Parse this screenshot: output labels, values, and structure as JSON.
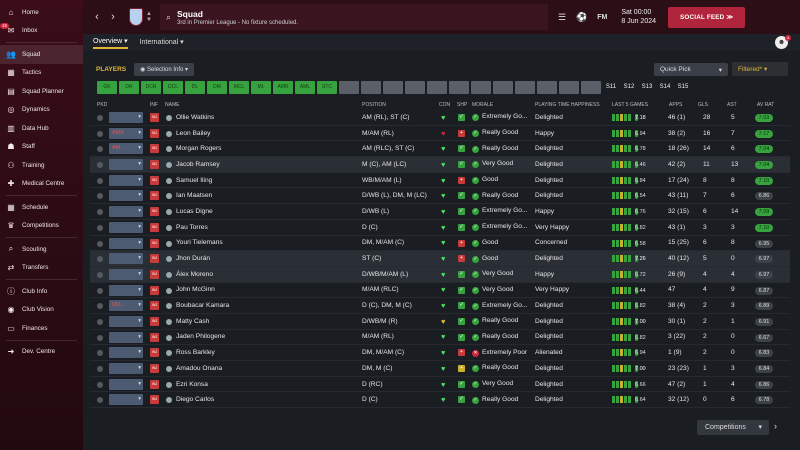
{
  "sidebar": {
    "inbox_badge": "15",
    "items": [
      {
        "label": "Home",
        "icon": "home-icon",
        "glyph": "⌂"
      },
      {
        "label": "Inbox",
        "icon": "inbox-icon",
        "glyph": "✉"
      },
      {
        "label": "Squad",
        "icon": "squad-icon",
        "glyph": "👥"
      },
      {
        "label": "Tactics",
        "icon": "tactics-icon",
        "glyph": "▦"
      },
      {
        "label": "Squad Planner",
        "icon": "planner-icon",
        "glyph": "▤"
      },
      {
        "label": "Dynamics",
        "icon": "dynamics-icon",
        "glyph": "◎"
      },
      {
        "label": "Data Hub",
        "icon": "data-hub-icon",
        "glyph": "▥"
      },
      {
        "label": "Staff",
        "icon": "staff-icon",
        "glyph": "☗"
      },
      {
        "label": "Training",
        "icon": "training-icon",
        "glyph": "⚇"
      },
      {
        "label": "Medical Centre",
        "icon": "medical-icon",
        "glyph": "✚"
      },
      {
        "label": "Schedule",
        "icon": "schedule-icon",
        "glyph": "▦"
      },
      {
        "label": "Competitions",
        "icon": "trophy-icon",
        "glyph": "♛"
      },
      {
        "label": "Scouting",
        "icon": "scouting-icon",
        "glyph": "⌕"
      },
      {
        "label": "Transfers",
        "icon": "transfers-icon",
        "glyph": "⇄"
      },
      {
        "label": "Club Info",
        "icon": "club-info-icon",
        "glyph": "ⓘ"
      },
      {
        "label": "Club Vision",
        "icon": "club-vision-icon",
        "glyph": "◉"
      },
      {
        "label": "Finances",
        "icon": "finances-icon",
        "glyph": "▭"
      },
      {
        "label": "Dev. Centre",
        "icon": "dev-centre-icon",
        "glyph": "➜"
      }
    ]
  },
  "topbar": {
    "title": "Squad",
    "subtitle": "3rd in Premier League - No fixture scheduled.",
    "time": "Sat 00:00",
    "date": "8 Jun 2024",
    "social_feed": "SOCIAL FEED",
    "fm_label": "FM"
  },
  "subbar": {
    "tabs": [
      "Overview",
      "International"
    ],
    "user_badge": "4"
  },
  "players_bar": {
    "label": "PLAYERS",
    "selection_info": "Selection Info",
    "quick_pick": "Quick Pick",
    "filtered": "Filtered*"
  },
  "chips": {
    "green": [
      "GK",
      "DR",
      "DCR",
      "DCL",
      "DL",
      "DM",
      "MCL",
      "ML",
      "AMR",
      "AML",
      "STC"
    ],
    "grey": [
      "",
      "",
      "",
      "",
      "",
      "",
      "",
      "",
      "",
      "",
      "",
      ""
    ],
    "text": [
      "S11",
      "S12",
      "S13",
      "S14",
      "S15"
    ]
  },
  "columns": {
    "pkd": "PKD",
    "inf": "INF",
    "name": "NAME",
    "position": "POSITION",
    "con": "CON",
    "shp": "SHP",
    "morale": "MORALE",
    "pth": "PLAYING TIME HAPPINESS",
    "last5": "LAST 5 GAMES",
    "apps": "APPS",
    "gls": "GLS",
    "ast": "AST",
    "avrat": "AV RAT"
  },
  "players": [
    {
      "pkd": "",
      "name": "Ollie Watkins",
      "pos": "AM (RL), ST (C)",
      "morale": "Extremely Go...",
      "pth": "Delighted",
      "last": "7.18",
      "apps": "46 (1)",
      "gls": "28",
      "ast": "5",
      "av": "7.03",
      "avg": true,
      "lastg": true,
      "con": "#4cd964",
      "shp": "#36a33e",
      "mor": "#36a33e"
    },
    {
      "pkd": "AMR",
      "name": "Leon Bailey",
      "pos": "M/AM (RL)",
      "morale": "Really Good",
      "pth": "Happy",
      "last": "6.94",
      "apps": "38 (2)",
      "gls": "16",
      "ast": "7",
      "av": "7.17",
      "avg": true,
      "lastg": false,
      "con": "#d0243a",
      "shp": "#c93a3a",
      "mor": "#36a33e"
    },
    {
      "pkd": "AM...",
      "name": "Morgan Rogers",
      "pos": "AM (RLC), ST (C)",
      "morale": "Really Good",
      "pth": "Delighted",
      "last": "6.78",
      "apps": "18 (26)",
      "gls": "14",
      "ast": "6",
      "av": "7.04",
      "avg": true,
      "lastg": false,
      "con": "#4cd964",
      "shp": "#36a33e",
      "mor": "#36a33e"
    },
    {
      "pkd": "",
      "name": "Jacob Ramsey",
      "pos": "M (C), AM (LC)",
      "morale": "Very Good",
      "pth": "Delighted",
      "last": "6.46",
      "apps": "42 (2)",
      "gls": "11",
      "ast": "13",
      "av": "7.04",
      "avg": true,
      "lastg": false,
      "con": "#4cd964",
      "shp": "#36a33e",
      "mor": "#36a33e"
    },
    {
      "pkd": "",
      "name": "Samuel Iling",
      "pos": "WB/M/AM (L)",
      "morale": "Good",
      "pth": "Delighted",
      "last": "6.84",
      "apps": "17 (24)",
      "gls": "8",
      "ast": "8",
      "av": "7.10",
      "avg": true,
      "lastg": false,
      "con": "#4cd964",
      "shp": "#c93a3a",
      "mor": "#36a33e"
    },
    {
      "pkd": "",
      "name": "Ian Maatsen",
      "pos": "D/WB (L), DM, M (LC)",
      "morale": "Really Good",
      "pth": "Delighted",
      "last": "6.54",
      "apps": "43 (11)",
      "gls": "7",
      "ast": "6",
      "av": "6.86",
      "avg": false,
      "lastg": false,
      "con": "#4cd964",
      "shp": "#36a33e",
      "mor": "#36a33e"
    },
    {
      "pkd": "",
      "name": "Lucas Digne",
      "pos": "D/WB (L)",
      "morale": "Extremely Go...",
      "pth": "Happy",
      "last": "6.76",
      "apps": "32 (15)",
      "gls": "6",
      "ast": "14",
      "av": "7.09",
      "avg": true,
      "lastg": false,
      "con": "#4cd964",
      "shp": "#36a33e",
      "mor": "#36a33e"
    },
    {
      "pkd": "",
      "name": "Pau Torres",
      "pos": "D (C)",
      "morale": "Extremely Go...",
      "pth": "Very Happy",
      "last": "6.82",
      "apps": "43 (1)",
      "gls": "3",
      "ast": "3",
      "av": "7.10",
      "avg": true,
      "lastg": false,
      "con": "#4cd964",
      "shp": "#36a33e",
      "mor": "#36a33e"
    },
    {
      "pkd": "",
      "name": "Youri Tielemans",
      "pos": "DM, M/AM (C)",
      "morale": "Good",
      "pth": "Concerned",
      "last": "6.58",
      "apps": "15 (25)",
      "gls": "6",
      "ast": "8",
      "av": "6.95",
      "avg": false,
      "lastg": false,
      "con": "#4cd964",
      "shp": "#c93a3a",
      "mor": "#36a33e"
    },
    {
      "pkd": "",
      "name": "Jhon Durán",
      "pos": "ST (C)",
      "morale": "Good",
      "pth": "Delighted",
      "last": "7.26",
      "apps": "40 (12)",
      "gls": "5",
      "ast": "0",
      "av": "6.97",
      "avg": false,
      "lastg": true,
      "con": "#4cd964",
      "shp": "#c93a3a",
      "mor": "#36a33e"
    },
    {
      "pkd": "",
      "name": "Álex Moreno",
      "pos": "D/WB/M/AM (L)",
      "morale": "Very Good",
      "pth": "Happy",
      "last": "6.72",
      "apps": "26 (9)",
      "gls": "4",
      "ast": "4",
      "av": "6.97",
      "avg": false,
      "lastg": false,
      "con": "#4cd964",
      "shp": "#36a33e",
      "mor": "#36a33e"
    },
    {
      "pkd": "",
      "name": "John McGinn",
      "pos": "M/AM (RLC)",
      "morale": "Very Good",
      "pth": "Very Happy",
      "last": "6.44",
      "apps": "47",
      "gls": "4",
      "ast": "9",
      "av": "6.87",
      "avg": false,
      "lastg": false,
      "con": "#4cd964",
      "shp": "#36a33e",
      "mor": "#36a33e"
    },
    {
      "pkd": "DM...",
      "name": "Boubacar Kamara",
      "pos": "D (C), DM, M (C)",
      "morale": "Extremely Go...",
      "pth": "Delighted",
      "last": "6.82",
      "apps": "38 (4)",
      "gls": "2",
      "ast": "3",
      "av": "6.89",
      "avg": false,
      "lastg": false,
      "con": "#4cd964",
      "shp": "#36a33e",
      "mor": "#36a33e"
    },
    {
      "pkd": "",
      "name": "Matty Cash",
      "pos": "D/WB/M (R)",
      "morale": "Really Good",
      "pth": "Delighted",
      "last": "7.00",
      "apps": "30 (1)",
      "gls": "2",
      "ast": "1",
      "av": "6.91",
      "avg": false,
      "lastg": true,
      "con": "#e0b53a",
      "shp": "#36a33e",
      "mor": "#36a33e"
    },
    {
      "pkd": "",
      "name": "Jaden Philogene",
      "pos": "M/AM (RL)",
      "morale": "Really Good",
      "pth": "Delighted",
      "last": "6.82",
      "apps": "3 (22)",
      "gls": "2",
      "ast": "0",
      "av": "6.67",
      "avg": false,
      "lastg": false,
      "con": "#4cd964",
      "shp": "#36a33e",
      "mor": "#36a33e"
    },
    {
      "pkd": "",
      "name": "Ross Barkley",
      "pos": "DM, M/AM (C)",
      "morale": "Extremely Poor",
      "pth": "Alienated",
      "last": "6.94",
      "apps": "1 (9)",
      "gls": "2",
      "ast": "0",
      "av": "6.83",
      "avg": false,
      "lastg": false,
      "con": "#4cd964",
      "shp": "#c93a3a",
      "mor": "#d0243a"
    },
    {
      "pkd": "",
      "name": "Amadou Onana",
      "pos": "DM, M (C)",
      "morale": "Really Good",
      "pth": "Delighted",
      "last": "7.00",
      "apps": "23 (23)",
      "gls": "1",
      "ast": "3",
      "av": "6.84",
      "avg": false,
      "lastg": true,
      "con": "#4cd964",
      "shp": "#c8b22a",
      "mor": "#36a33e"
    },
    {
      "pkd": "",
      "name": "Ezri Konsa",
      "pos": "D (RC)",
      "morale": "Very Good",
      "pth": "Delighted",
      "last": "6.66",
      "apps": "47 (2)",
      "gls": "1",
      "ast": "4",
      "av": "6.86",
      "avg": false,
      "lastg": false,
      "con": "#4cd964",
      "shp": "#36a33e",
      "mor": "#36a33e"
    },
    {
      "pkd": "",
      "name": "Diego Carlos",
      "pos": "D (C)",
      "morale": "Really Good",
      "pth": "Delighted",
      "last": "6.64",
      "apps": "32 (12)",
      "gls": "0",
      "ast": "6",
      "av": "6.78",
      "avg": false,
      "lastg": false,
      "con": "#4cd964",
      "shp": "#36a33e",
      "mor": "#36a33e"
    }
  ],
  "bottom": {
    "competitions": "Competitions"
  }
}
